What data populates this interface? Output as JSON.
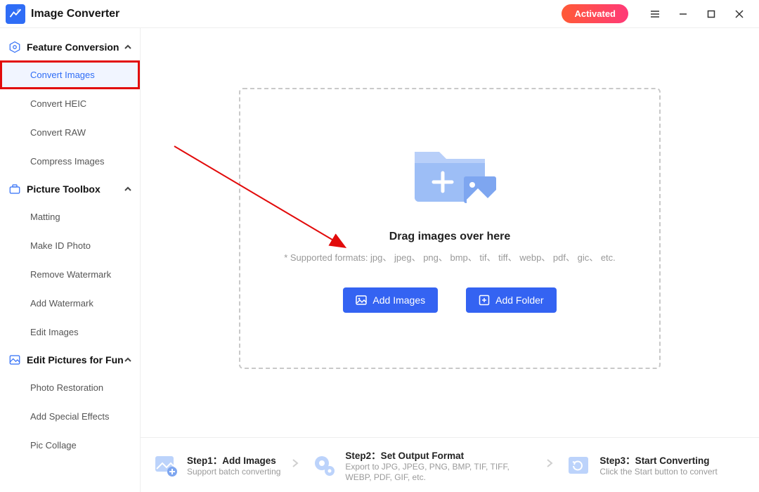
{
  "titlebar": {
    "app_title": "Image Converter",
    "activated_label": "Activated"
  },
  "sidebar": {
    "groups": [
      {
        "header": "Feature Conversion",
        "items": [
          {
            "label": "Convert Images",
            "active": true,
            "highlight": true
          },
          {
            "label": "Convert HEIC"
          },
          {
            "label": "Convert RAW"
          },
          {
            "label": "Compress Images"
          }
        ]
      },
      {
        "header": "Picture Toolbox",
        "items": [
          {
            "label": "Matting"
          },
          {
            "label": "Make ID Photo"
          },
          {
            "label": "Remove Watermark"
          },
          {
            "label": "Add Watermark"
          },
          {
            "label": "Edit Images"
          }
        ]
      },
      {
        "header": "Edit Pictures for Fun",
        "items": [
          {
            "label": "Photo Restoration"
          },
          {
            "label": "Add Special Effects"
          },
          {
            "label": "Pic Collage"
          }
        ]
      }
    ]
  },
  "dropzone": {
    "drag_text": "Drag images over here",
    "formats_text": "* Supported formats: jpg、 jpeg、 png、 bmp、 tif、 tiff、 webp、 pdf、 gic、 etc.",
    "add_images_label": "Add Images",
    "add_folder_label": "Add Folder"
  },
  "steps": {
    "step1": {
      "title": "Step1：Add Images",
      "sub": "Support batch converting"
    },
    "step2": {
      "title": "Step2：Set Output Format",
      "sub": "Export to JPG, JPEG, PNG, BMP, TIF, TIFF, WEBP, PDF, GIF, etc."
    },
    "step3": {
      "title": "Step3：Start Converting",
      "sub": "Click the Start button to convert"
    }
  },
  "colors": {
    "accent": "#3463f2",
    "highlight_border": "#e20b0b"
  }
}
